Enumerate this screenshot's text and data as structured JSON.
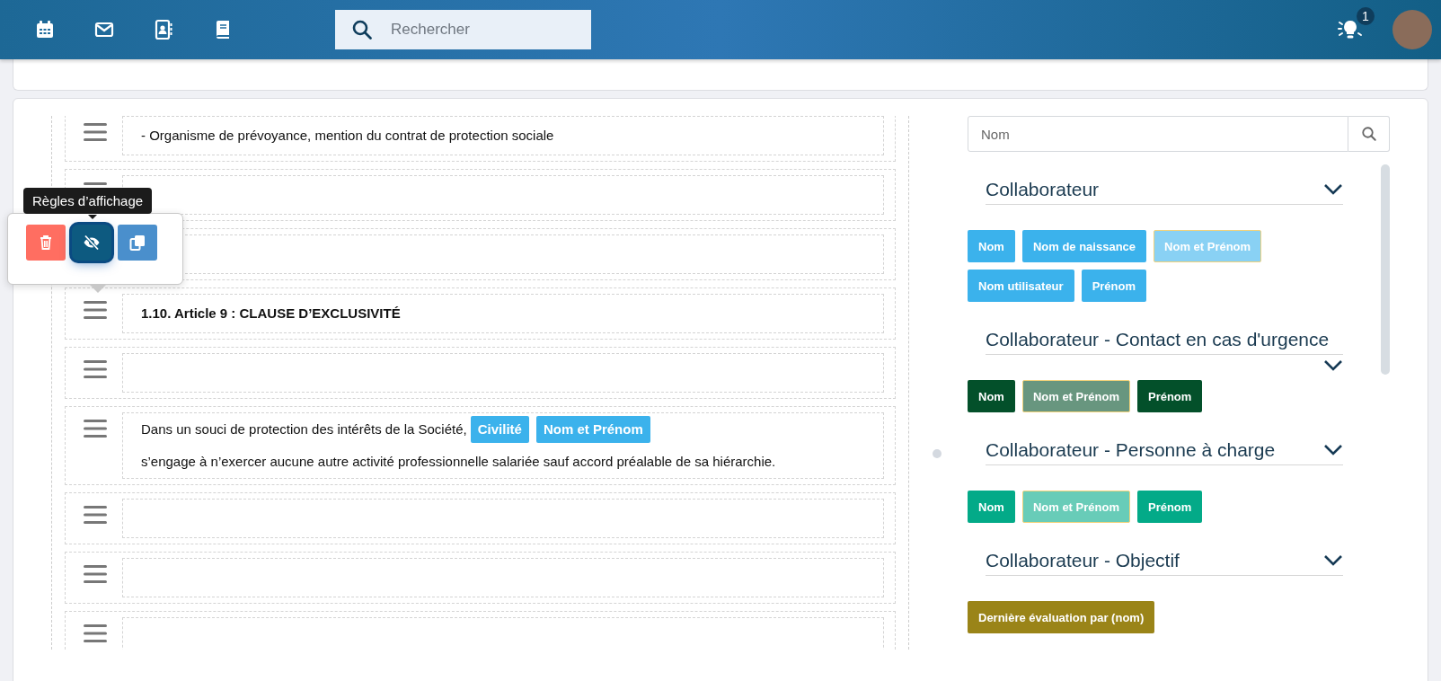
{
  "header": {
    "search": {
      "placeholder": "Rechercher"
    },
    "notifications": {
      "count": "1"
    }
  },
  "editor": {
    "rows": [
      {
        "kind": "text",
        "text": "- Organisme de prévoyance, mention du contrat de protection sociale"
      },
      {
        "kind": "empty"
      },
      {
        "kind": "empty"
      },
      {
        "kind": "heading",
        "text": "1.10. Article 9 : CLAUSE D’EXCLUSIVITÉ"
      },
      {
        "kind": "empty"
      },
      {
        "kind": "rich",
        "parts": [
          {
            "kind": "text",
            "text": "Dans un souci de protection des intérêts de la Société,"
          },
          {
            "kind": "chip",
            "text": "Civilité"
          },
          {
            "kind": "chip",
            "text": "Nom et Prénom"
          },
          {
            "kind": "text",
            "text": "s’engage à n’exercer aucune autre activité professionnelle salariée sauf accord préalable de sa hiérarchie."
          }
        ]
      },
      {
        "kind": "empty"
      },
      {
        "kind": "empty"
      },
      {
        "kind": "empty"
      }
    ]
  },
  "row_toolbar": {
    "tooltip": "Règles d’affichage",
    "buttons": [
      {
        "kind": "delete",
        "selected": false
      },
      {
        "kind": "visibility",
        "selected": true
      },
      {
        "kind": "copy",
        "selected": false
      }
    ]
  },
  "fields_panel": {
    "search": {
      "placeholder": "Nom"
    },
    "groups": [
      {
        "title": "Collaborateur",
        "color": "#3bb2ec",
        "tags": [
          {
            "label": "Nom",
            "selected": false
          },
          {
            "label": "Nom de naissance",
            "selected": false
          },
          {
            "label": "Nom et Prénom",
            "selected": true
          },
          {
            "label": "Nom utilisateur",
            "selected": false
          },
          {
            "label": "Prénom",
            "selected": false
          }
        ]
      },
      {
        "title": "Collaborateur - Contact en cas d'urgence",
        "color": "#03502a",
        "tags": [
          {
            "label": "Nom",
            "selected": false
          },
          {
            "label": "Nom et Prénom",
            "selected": true
          },
          {
            "label": "Prénom",
            "selected": false
          }
        ]
      },
      {
        "title": "Collaborateur - Personne à charge",
        "color": "#03aa88",
        "tags": [
          {
            "label": "Nom",
            "selected": false
          },
          {
            "label": "Nom et Prénom",
            "selected": true
          },
          {
            "label": "Prénom",
            "selected": false
          }
        ]
      },
      {
        "title": "Collaborateur - Objectif",
        "color": "#9a8418",
        "tags": [
          {
            "label": "Dernière évaluation par (nom)",
            "selected": false
          }
        ]
      }
    ]
  }
}
